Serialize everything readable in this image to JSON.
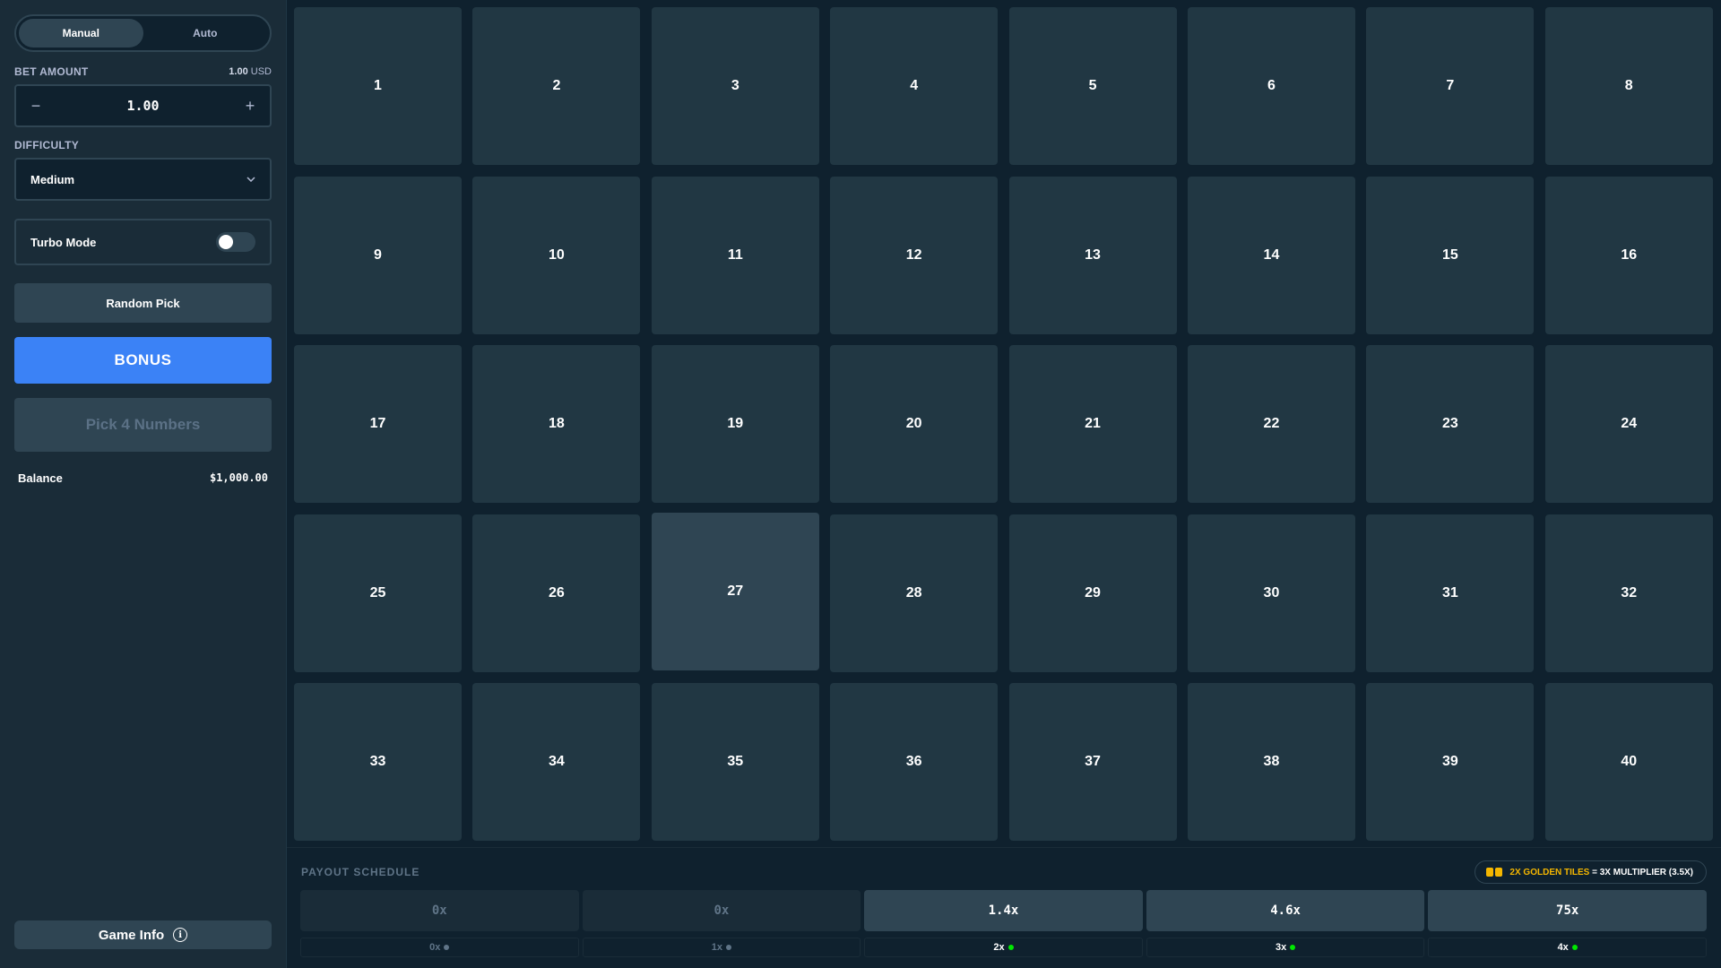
{
  "sidebar": {
    "mode_tabs": [
      {
        "label": "Manual",
        "active": true
      },
      {
        "label": "Auto",
        "active": false
      }
    ],
    "bet_amount": {
      "label": "BET AMOUNT",
      "usd_value": "1.00",
      "usd_unit": "USD",
      "value": "1.00",
      "minus": "−",
      "plus": "+"
    },
    "difficulty": {
      "label": "DIFFICULTY",
      "value": "Medium"
    },
    "turbo_mode": {
      "label": "Turbo Mode",
      "enabled": false
    },
    "random_pick_label": "Random Pick",
    "bonus_label": "BONUS",
    "pick_label": "Pick 4 Numbers",
    "balance": {
      "label": "Balance",
      "value": "$1,000.00"
    },
    "game_info_label": "Game Info"
  },
  "grid": {
    "tiles": [
      "1",
      "2",
      "3",
      "4",
      "5",
      "6",
      "7",
      "8",
      "9",
      "10",
      "11",
      "12",
      "13",
      "14",
      "15",
      "16",
      "17",
      "18",
      "19",
      "20",
      "21",
      "22",
      "23",
      "24",
      "25",
      "26",
      "27",
      "28",
      "29",
      "30",
      "31",
      "32",
      "33",
      "34",
      "35",
      "36",
      "37",
      "38",
      "39",
      "40"
    ],
    "hovered_tile": "27"
  },
  "payout": {
    "title": "PAYOUT SCHEDULE",
    "golden": {
      "text": "2X GOLDEN TILES",
      "eq": "= 3X MULTIPLIER (3.5X)"
    },
    "multipliers": [
      {
        "value": "0x",
        "lit": false
      },
      {
        "value": "0x",
        "lit": false
      },
      {
        "value": "1.4x",
        "lit": true
      },
      {
        "value": "4.6x",
        "lit": true
      },
      {
        "value": "75x",
        "lit": true
      }
    ],
    "hits": [
      {
        "label": "0x",
        "lit": false
      },
      {
        "label": "1x",
        "lit": false
      },
      {
        "label": "2x",
        "lit": true
      },
      {
        "label": "3x",
        "lit": true
      },
      {
        "label": "4x",
        "lit": true
      }
    ]
  },
  "colors": {
    "background": "#0f212e",
    "sidebar": "#1a2c38",
    "tile": "#213743",
    "tile_hover": "#2f4553",
    "accent_blue": "#3b82f6",
    "gold": "#f5b700",
    "green_dot": "#00e701"
  }
}
